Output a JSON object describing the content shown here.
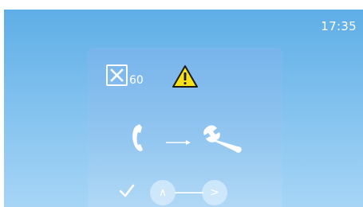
{
  "status_bar": {
    "time": "17:35"
  },
  "dialog": {
    "timeout_count": "60",
    "timeout_icon": "close-box-icon",
    "warning_icon": "warning-triangle-icon",
    "flow": {
      "from_icon": "phone-handset-icon",
      "arrow_icon": "arrow-right-icon",
      "to_icon": "wrench-icon"
    },
    "controls": {
      "confirm_icon": "checkmark-icon",
      "up_label": "∧",
      "next_label": ">"
    }
  },
  "colors": {
    "screen_top": "#5eaee6",
    "screen_bottom": "#a6d5f6",
    "warning_fill": "#f7e21a",
    "warning_stroke": "#1a1a1a",
    "foreground": "#ffffff"
  }
}
